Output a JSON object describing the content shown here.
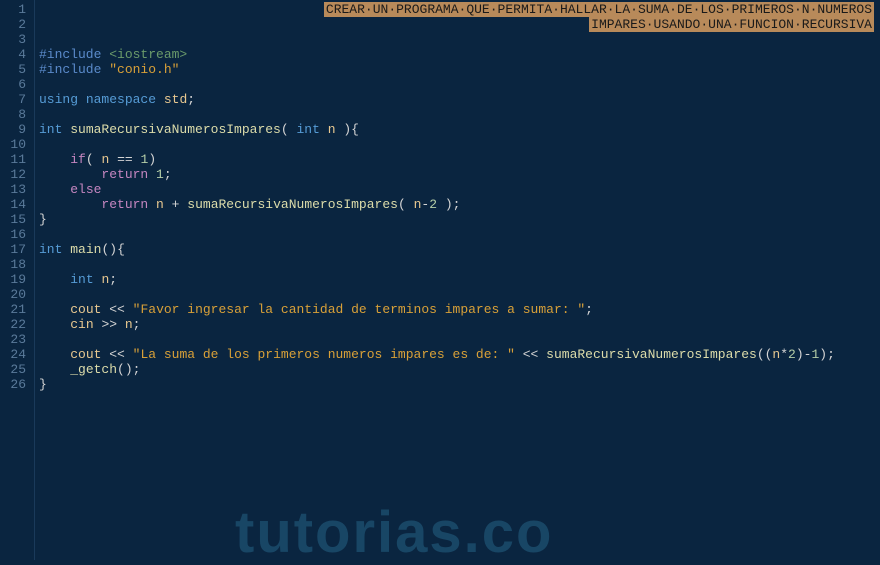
{
  "editor": {
    "line_count": 26,
    "watermark": "tutorias.co",
    "comment": {
      "line1": "CREAR·UN·PROGRAMA·QUE·PERMITA·HALLAR·LA·SUMA·DE·LOS·PRIMEROS·N·NUMEROS",
      "line2": "IMPARES·USANDO·UNA·FUNCION·RECURSIVA"
    },
    "tokens": {
      "include1_pp": "#include ",
      "include1_lib": "<iostream>",
      "include2_pp": "#include ",
      "include2_lib": "\"conio.h\"",
      "using": "using",
      "namespace": "namespace",
      "std": "std",
      "semi": ";",
      "int": "int",
      "func_name": "sumaRecursivaNumerosImpares",
      "lparen": "(",
      "rparen": ")",
      "param_n": "n",
      "lbrace": "{",
      "rbrace": "}",
      "if": "if",
      "eq": "==",
      "one": "1",
      "return": "return",
      "else": "else",
      "plus": "+",
      "minus": "-",
      "two": "2",
      "main": "main",
      "cout": "cout",
      "cin": "cin",
      "lshift": "<<",
      "rshift": ">>",
      "str1": "\"Favor ingresar la cantidad de terminos impares a sumar: \"",
      "str2": "\"La suma de los primeros numeros impares es de: \"",
      "star": "*",
      "getch": "_getch",
      "call_open": "((",
      "call_close": ");"
    }
  }
}
